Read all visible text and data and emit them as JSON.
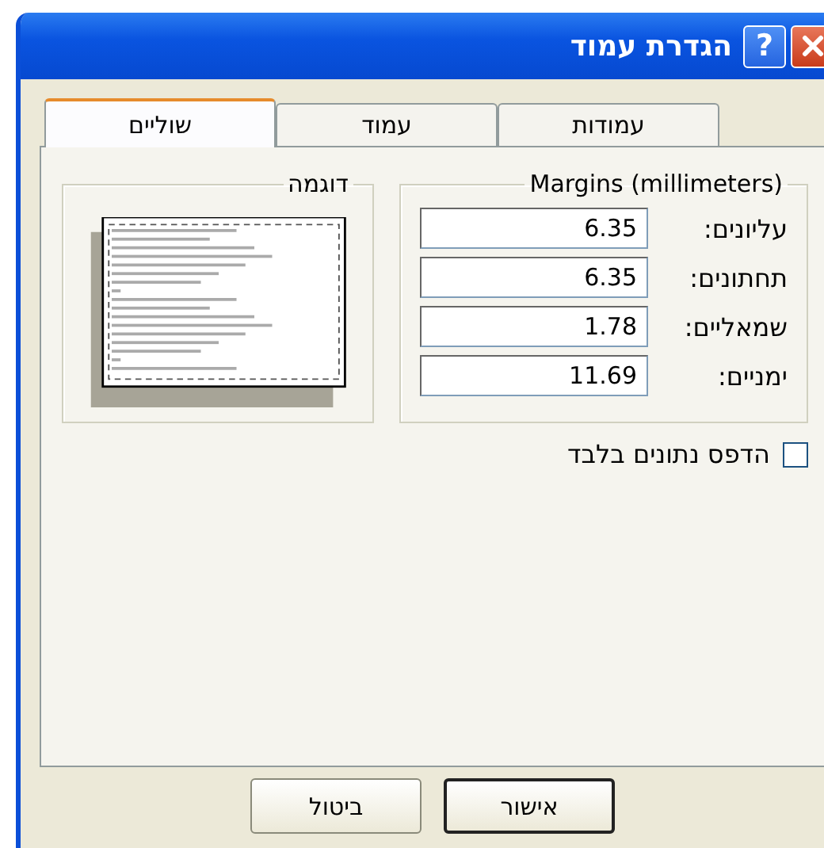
{
  "window": {
    "title": "הגדרת עמוד",
    "help_button": "?"
  },
  "tabs": [
    {
      "label": "עמודות",
      "selected": false
    },
    {
      "label": "עמוד",
      "selected": false
    },
    {
      "label": "שוליים",
      "selected": true
    }
  ],
  "margins_group": {
    "title": "Margins (millimeters)",
    "fields": [
      {
        "label": "עליונים:",
        "value": "6.35"
      },
      {
        "label": "תחתונים:",
        "value": "6.35"
      },
      {
        "label": "שמאליים:",
        "value": "1.78"
      },
      {
        "label": "ימניים:",
        "value": "11.69"
      }
    ]
  },
  "preview_group": {
    "title": "דוגמה"
  },
  "print_data_only": {
    "label": "הדפס נתונים בלבד",
    "checked": false
  },
  "buttons": [
    {
      "label": "אישור",
      "default": true
    },
    {
      "label": "ביטול",
      "default": false
    }
  ]
}
